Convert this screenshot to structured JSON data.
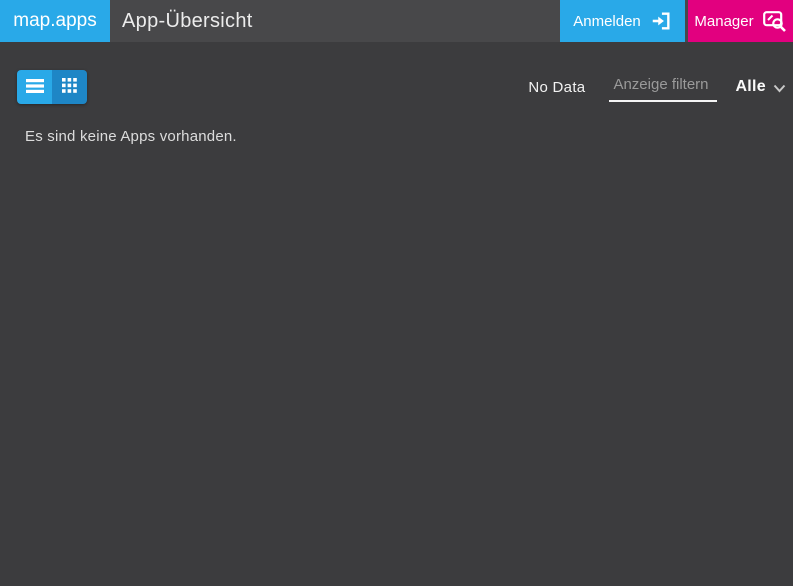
{
  "header": {
    "brand": "map.apps",
    "title": "App-Übersicht",
    "anmelden_label": "Anmelden",
    "manager_label": "Manager"
  },
  "toolbar": {
    "status_text": "No Data",
    "filter_placeholder": "Anzeige filtern",
    "filter_value": "",
    "dropdown_value": "Alle"
  },
  "main": {
    "empty_message": "Es sind keine Apps vorhanden."
  },
  "icons": {
    "list_view": "list-icon",
    "grid_view": "grid-icon",
    "login": "sign-in-icon",
    "manager": "manager-magnifier-icon",
    "dropdown": "chevron-down-icon"
  },
  "colors": {
    "brand_blue": "#29A9E8",
    "brand_magenta": "#E2007F",
    "header_bg": "#48484A",
    "body_bg": "#3C3C3E",
    "grid_button_blue": "#1E86C6"
  }
}
